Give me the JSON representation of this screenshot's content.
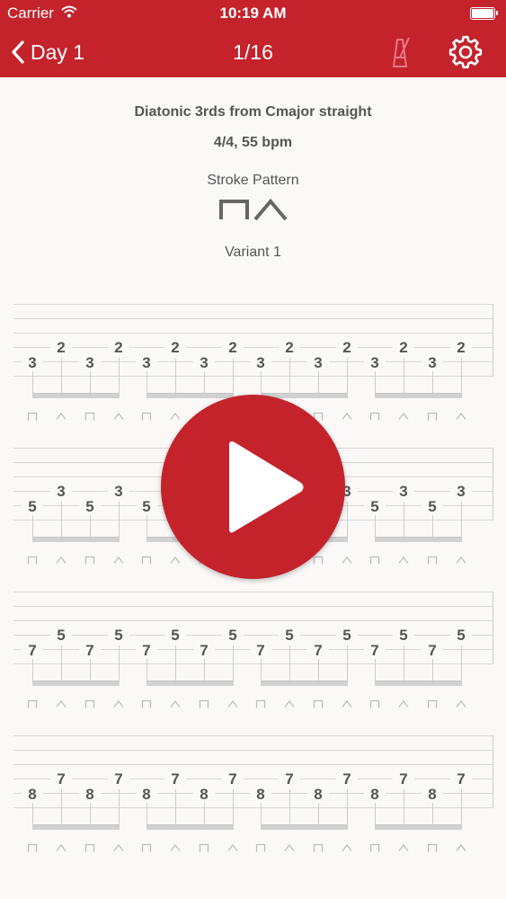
{
  "status_bar": {
    "carrier": "Carrier",
    "time": "10:19 AM"
  },
  "nav": {
    "back_label": "Day 1",
    "title": "1/16"
  },
  "exercise": {
    "title": "Diatonic 3rds from Cmajor straight",
    "tempo": "4/4, 55 bpm",
    "stroke_pattern_label": "Stroke Pattern",
    "variant": "Variant 1"
  },
  "tab": {
    "systems": [
      {
        "low": "3",
        "high": "2"
      },
      {
        "low": "5",
        "high": "3"
      },
      {
        "low": "7",
        "high": "5"
      },
      {
        "low": "8",
        "high": "7"
      }
    ],
    "stroke_sequence": [
      "down",
      "up",
      "down",
      "up"
    ]
  },
  "colors": {
    "accent": "#c4232c",
    "text": "#555555",
    "background": "#fbf9f8"
  },
  "icons": {
    "back": "chevron-left-icon",
    "metronome": "metronome-icon",
    "settings": "gear-icon",
    "play": "play-icon",
    "down_stroke": "down-stroke-icon",
    "up_stroke": "up-stroke-icon"
  }
}
